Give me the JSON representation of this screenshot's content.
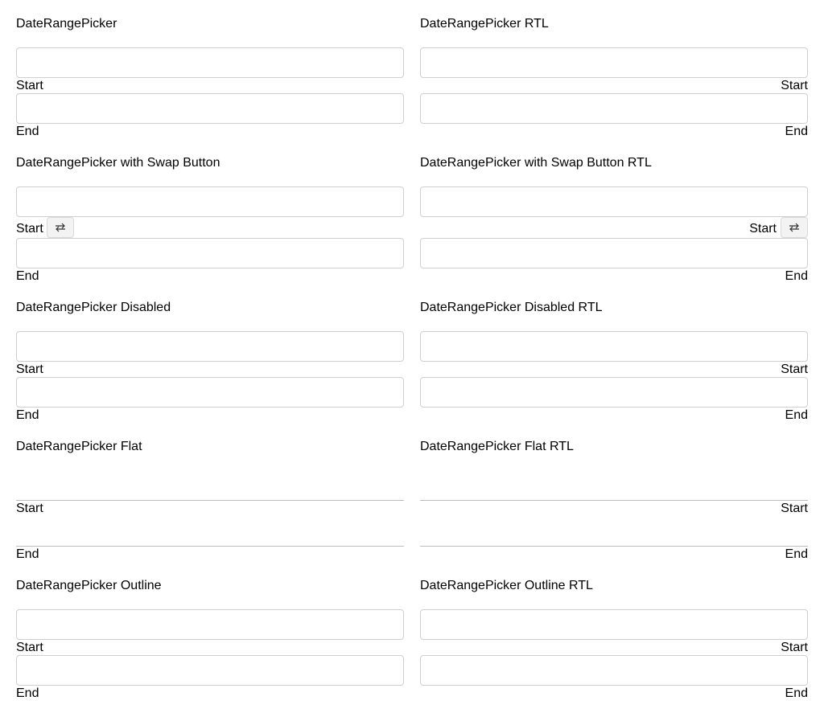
{
  "sections": [
    {
      "left_title": "DateRangePicker",
      "right_title": "DateRangePicker RTL"
    },
    {
      "left_title": "DateRangePicker with Swap Button",
      "right_title": "DateRangePicker with Swap Button RTL"
    },
    {
      "left_title": "DateRangePicker Disabled",
      "right_title": "DateRangePicker Disabled RTL"
    },
    {
      "left_title": "DateRangePicker Flat",
      "right_title": "DateRangePicker Flat RTL"
    },
    {
      "left_title": "DateRangePicker Outline",
      "right_title": "DateRangePicker Outline RTL"
    }
  ],
  "labels": {
    "start": "Start",
    "end": "End"
  },
  "icons": {
    "swap": "swap-arrows-icon"
  },
  "colors": {
    "border": "#cfcfcf",
    "flat_border": "#bdbdbd",
    "swap_bg": "#f3f3f3"
  }
}
